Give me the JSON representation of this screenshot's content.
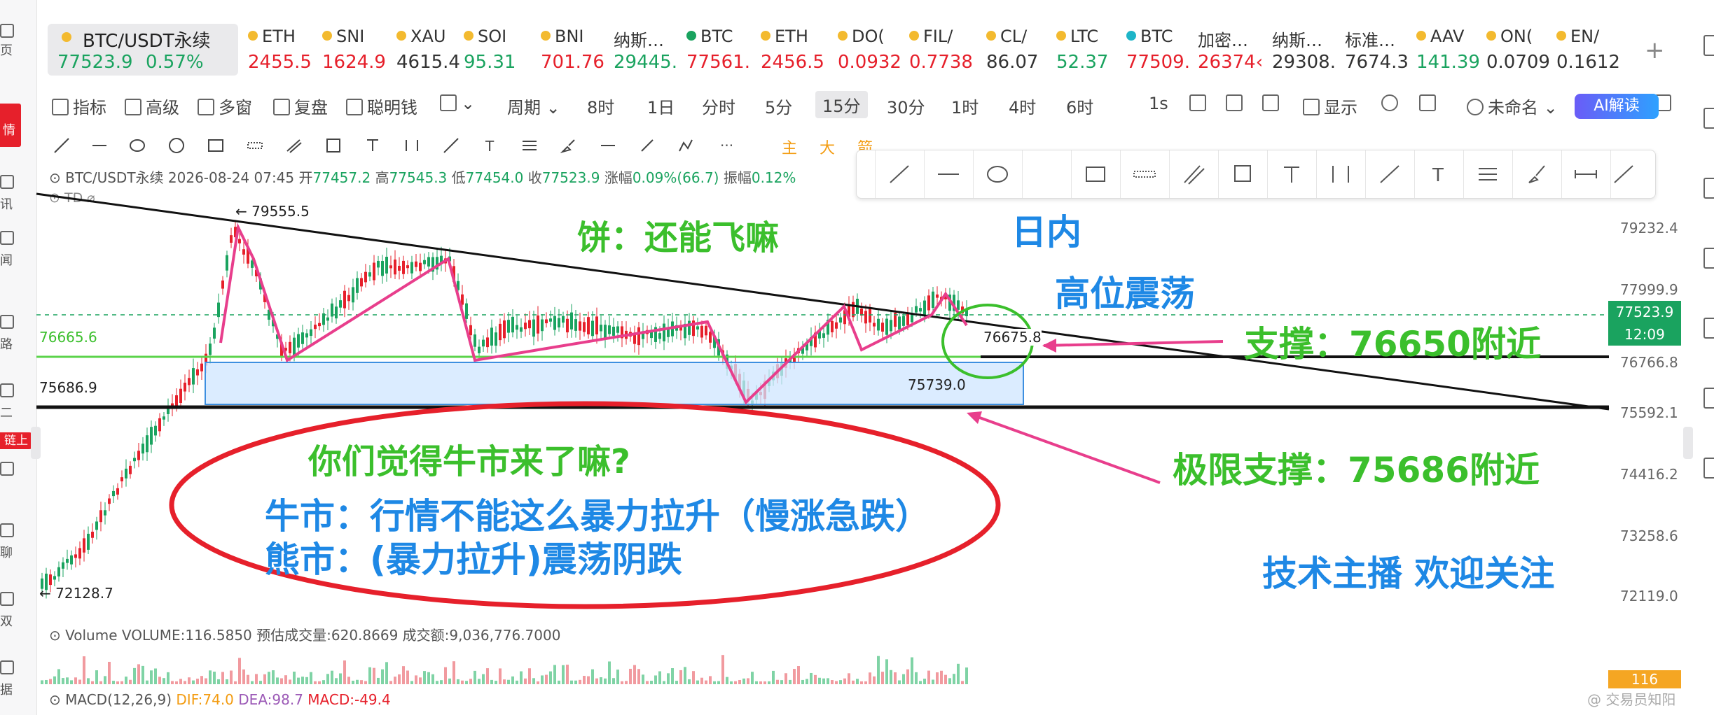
{
  "sidebar": {
    "items": [
      {
        "label": "页"
      },
      {
        "label": "行情"
      },
      {
        "label": "讯"
      },
      {
        "label": "闻"
      },
      {
        "label": "路"
      },
      {
        "label": "二"
      },
      {
        "label": "链上"
      },
      {
        "label": "聊"
      },
      {
        "label": "双"
      },
      {
        "label": "据"
      }
    ],
    "active_label": "情",
    "chain_badge": "链上"
  },
  "tickers": {
    "main": {
      "name": "BTC/USDT永续",
      "price": "77523.9",
      "change": "0.57%"
    },
    "items": [
      {
        "symbol": "ETH",
        "price": "2455.5",
        "dir": "dn"
      },
      {
        "symbol": "SNI",
        "price": "1624.9",
        "dir": "dn"
      },
      {
        "symbol": "XAU",
        "price": "4615.4",
        "dir": "nt"
      },
      {
        "symbol": "SOI",
        "price": "95.31",
        "dir": "up"
      },
      {
        "symbol": "BNI",
        "price": "701.76",
        "dir": "dn"
      },
      {
        "symbol": "纳斯…",
        "price": "29445.",
        "dir": "up"
      },
      {
        "symbol": "BTC",
        "price": "77561.",
        "dir": "dn"
      },
      {
        "symbol": "ETH",
        "price": "2456.5",
        "dir": "dn"
      },
      {
        "symbol": "DO(",
        "price": "0.0932",
        "dir": "dn"
      },
      {
        "symbol": "FIL/",
        "price": "0.7738",
        "dir": "dn"
      },
      {
        "symbol": "CL/",
        "price": "86.07",
        "dir": "nt"
      },
      {
        "symbol": "LTC",
        "price": "52.37",
        "dir": "up"
      },
      {
        "symbol": "BTC",
        "price": "77509.",
        "dir": "dn"
      },
      {
        "symbol": "加密…",
        "price": "26374‹",
        "dir": "dn"
      },
      {
        "symbol": "纳斯…",
        "price": "29308.",
        "dir": "nt"
      },
      {
        "symbol": "标准…",
        "price": "7674.3",
        "dir": "nt"
      },
      {
        "symbol": "AAV",
        "price": "141.39",
        "dir": "up"
      },
      {
        "symbol": "ON(",
        "price": "0.0709",
        "dir": "nt"
      },
      {
        "symbol": "EN/",
        "price": "0.1612",
        "dir": "nt"
      }
    ],
    "add": "+"
  },
  "toolbar": {
    "indicators": "指标",
    "advanced": "高级",
    "multi_window": "多窗",
    "replay": "复盘",
    "smart_money": "聪明钱",
    "period": "周期",
    "intervals": [
      "8时",
      "1日",
      "分时",
      "5分",
      "15分",
      "30分",
      "1时",
      "4时",
      "6时"
    ],
    "active_interval": "15分",
    "interval_1s": "1s",
    "unnamed": "未命名",
    "display": "显示",
    "ai": "AI解读"
  },
  "drawing_toolbar": {
    "more": "···",
    "main_tab": "主",
    "big": "大",
    "camp": "箭"
  },
  "chart_header": {
    "symbol": "BTC/USDT永续",
    "datetime": "2026-08-24 07:45",
    "open_label": "开",
    "open": "77457.2",
    "high_label": "高",
    "high": "77545.3",
    "low_label": "低",
    "low": "77454.0",
    "close_label": "收",
    "close": "77523.9",
    "change_label": "涨幅",
    "change": "0.09%(66.7)",
    "amp_label": "振幅",
    "amp": "0.12%",
    "td": "TD"
  },
  "price_axis": {
    "labels": [
      "79232.4",
      "77999.9",
      "77523.9",
      "76766.8",
      "75592.1",
      "74416.2",
      "73258.6",
      "72119.0"
    ],
    "current_price": "77523.9",
    "countdown": "12:09",
    "volume_tag": "116"
  },
  "chart_labels": {
    "high_marker": "← 79555.5",
    "low_marker": "← 72128.7",
    "level_green": "76665.6",
    "level_black": "75686.9",
    "box_value": "75739.0",
    "circle_value": "76675.8"
  },
  "annotations": {
    "bing": "饼：还能飞嘛",
    "intraday": "日内",
    "high_range": "高位震荡",
    "support": "支撑：76650附近",
    "limit_support": "极限支撑：75686附近",
    "question": "你们觉得牛市来了嘛?",
    "bull": "牛市：行情不能这么暴力拉升（慢涨急跌）",
    "bear": "熊市：(暴力拉升)震荡阴跌",
    "host": "技术主播  欢迎关注"
  },
  "volume": {
    "legend": "Volume  VOLUME:116.5850  预估成交量:620.8669  成交额:9,036,776.7000"
  },
  "macd": {
    "title": "MACD(12,26,9)",
    "dif": "DIF:74.0",
    "dea": "DEA:98.7",
    "macd": "MACD:-49.4"
  },
  "watermark": "@ 交易员知阳",
  "colors": {
    "up": "#1aa35f",
    "down": "#e6202b",
    "annotation_green": "#3bbf2c",
    "annotation_blue": "#1e88e5",
    "arrow_pink": "#e83e8c",
    "box_fill": "#cfe6ff"
  }
}
